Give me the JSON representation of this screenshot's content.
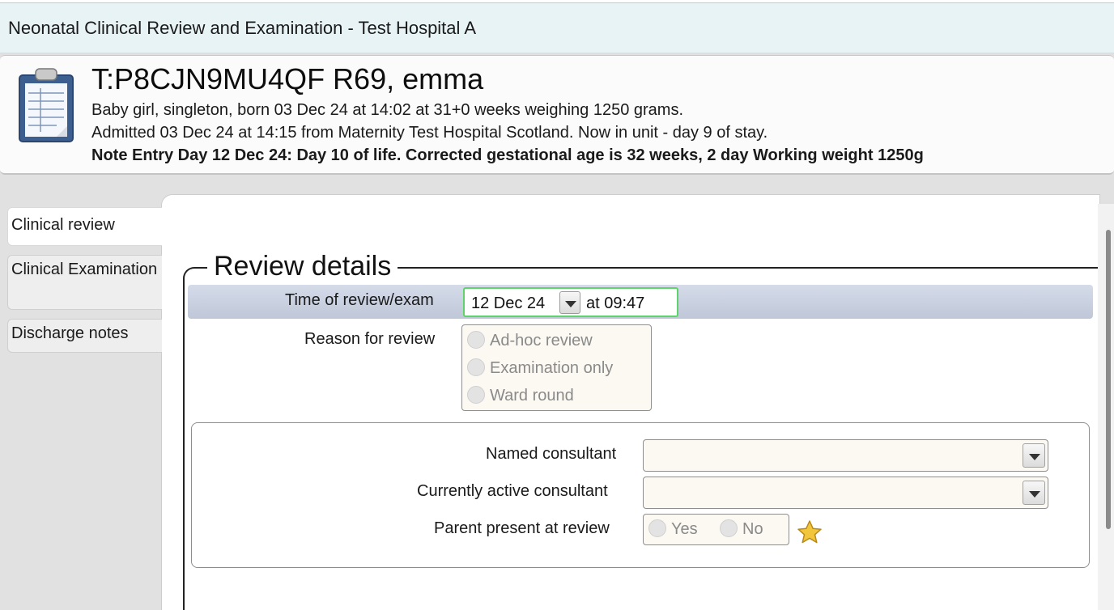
{
  "window": {
    "title": "Neonatal Clinical Review and Examination - Test Hospital A"
  },
  "patient": {
    "name": "T:P8CJN9MU4QF R69, emma",
    "birth_line": "Baby girl, singleton, born 03 Dec 24 at 14:02 at 31+0 weeks weighing 1250 grams.",
    "admission_line": "Admitted 03 Dec 24 at 14:15 from Maternity Test Hospital Scotland.  Now in unit - day 9 of stay.",
    "note_line": "Note Entry Day 12 Dec 24: Day 10 of life. Corrected gestational age is 32 weeks, 2 day Working weight 1250g",
    "icon": "clipboard-icon"
  },
  "tabs": [
    {
      "label": "Clinical review",
      "active": true
    },
    {
      "label": "Clinical Examination",
      "active": false
    },
    {
      "label": "Discharge notes",
      "active": false
    }
  ],
  "review": {
    "section_title": "Review details",
    "time_label": "Time of review/exam",
    "date_value": "12 Dec 24",
    "time_value": "at 09:47",
    "reason_label": "Reason for review",
    "reason_options": [
      "Ad-hoc review",
      "Examination only",
      "Ward round"
    ],
    "named_consultant_label": "Named consultant",
    "named_consultant_value": "",
    "active_consultant_label": "Currently active consultant",
    "active_consultant_value": "",
    "parent_present_label": "Parent present at review",
    "parent_options": [
      "Yes",
      "No"
    ]
  },
  "colors": {
    "title_bg": "#e8f3f6",
    "highlight_band": "#c9d0e0",
    "focus_border": "#5fd36b",
    "input_bg": "#fcf8f2",
    "star": "#f2c63a"
  }
}
